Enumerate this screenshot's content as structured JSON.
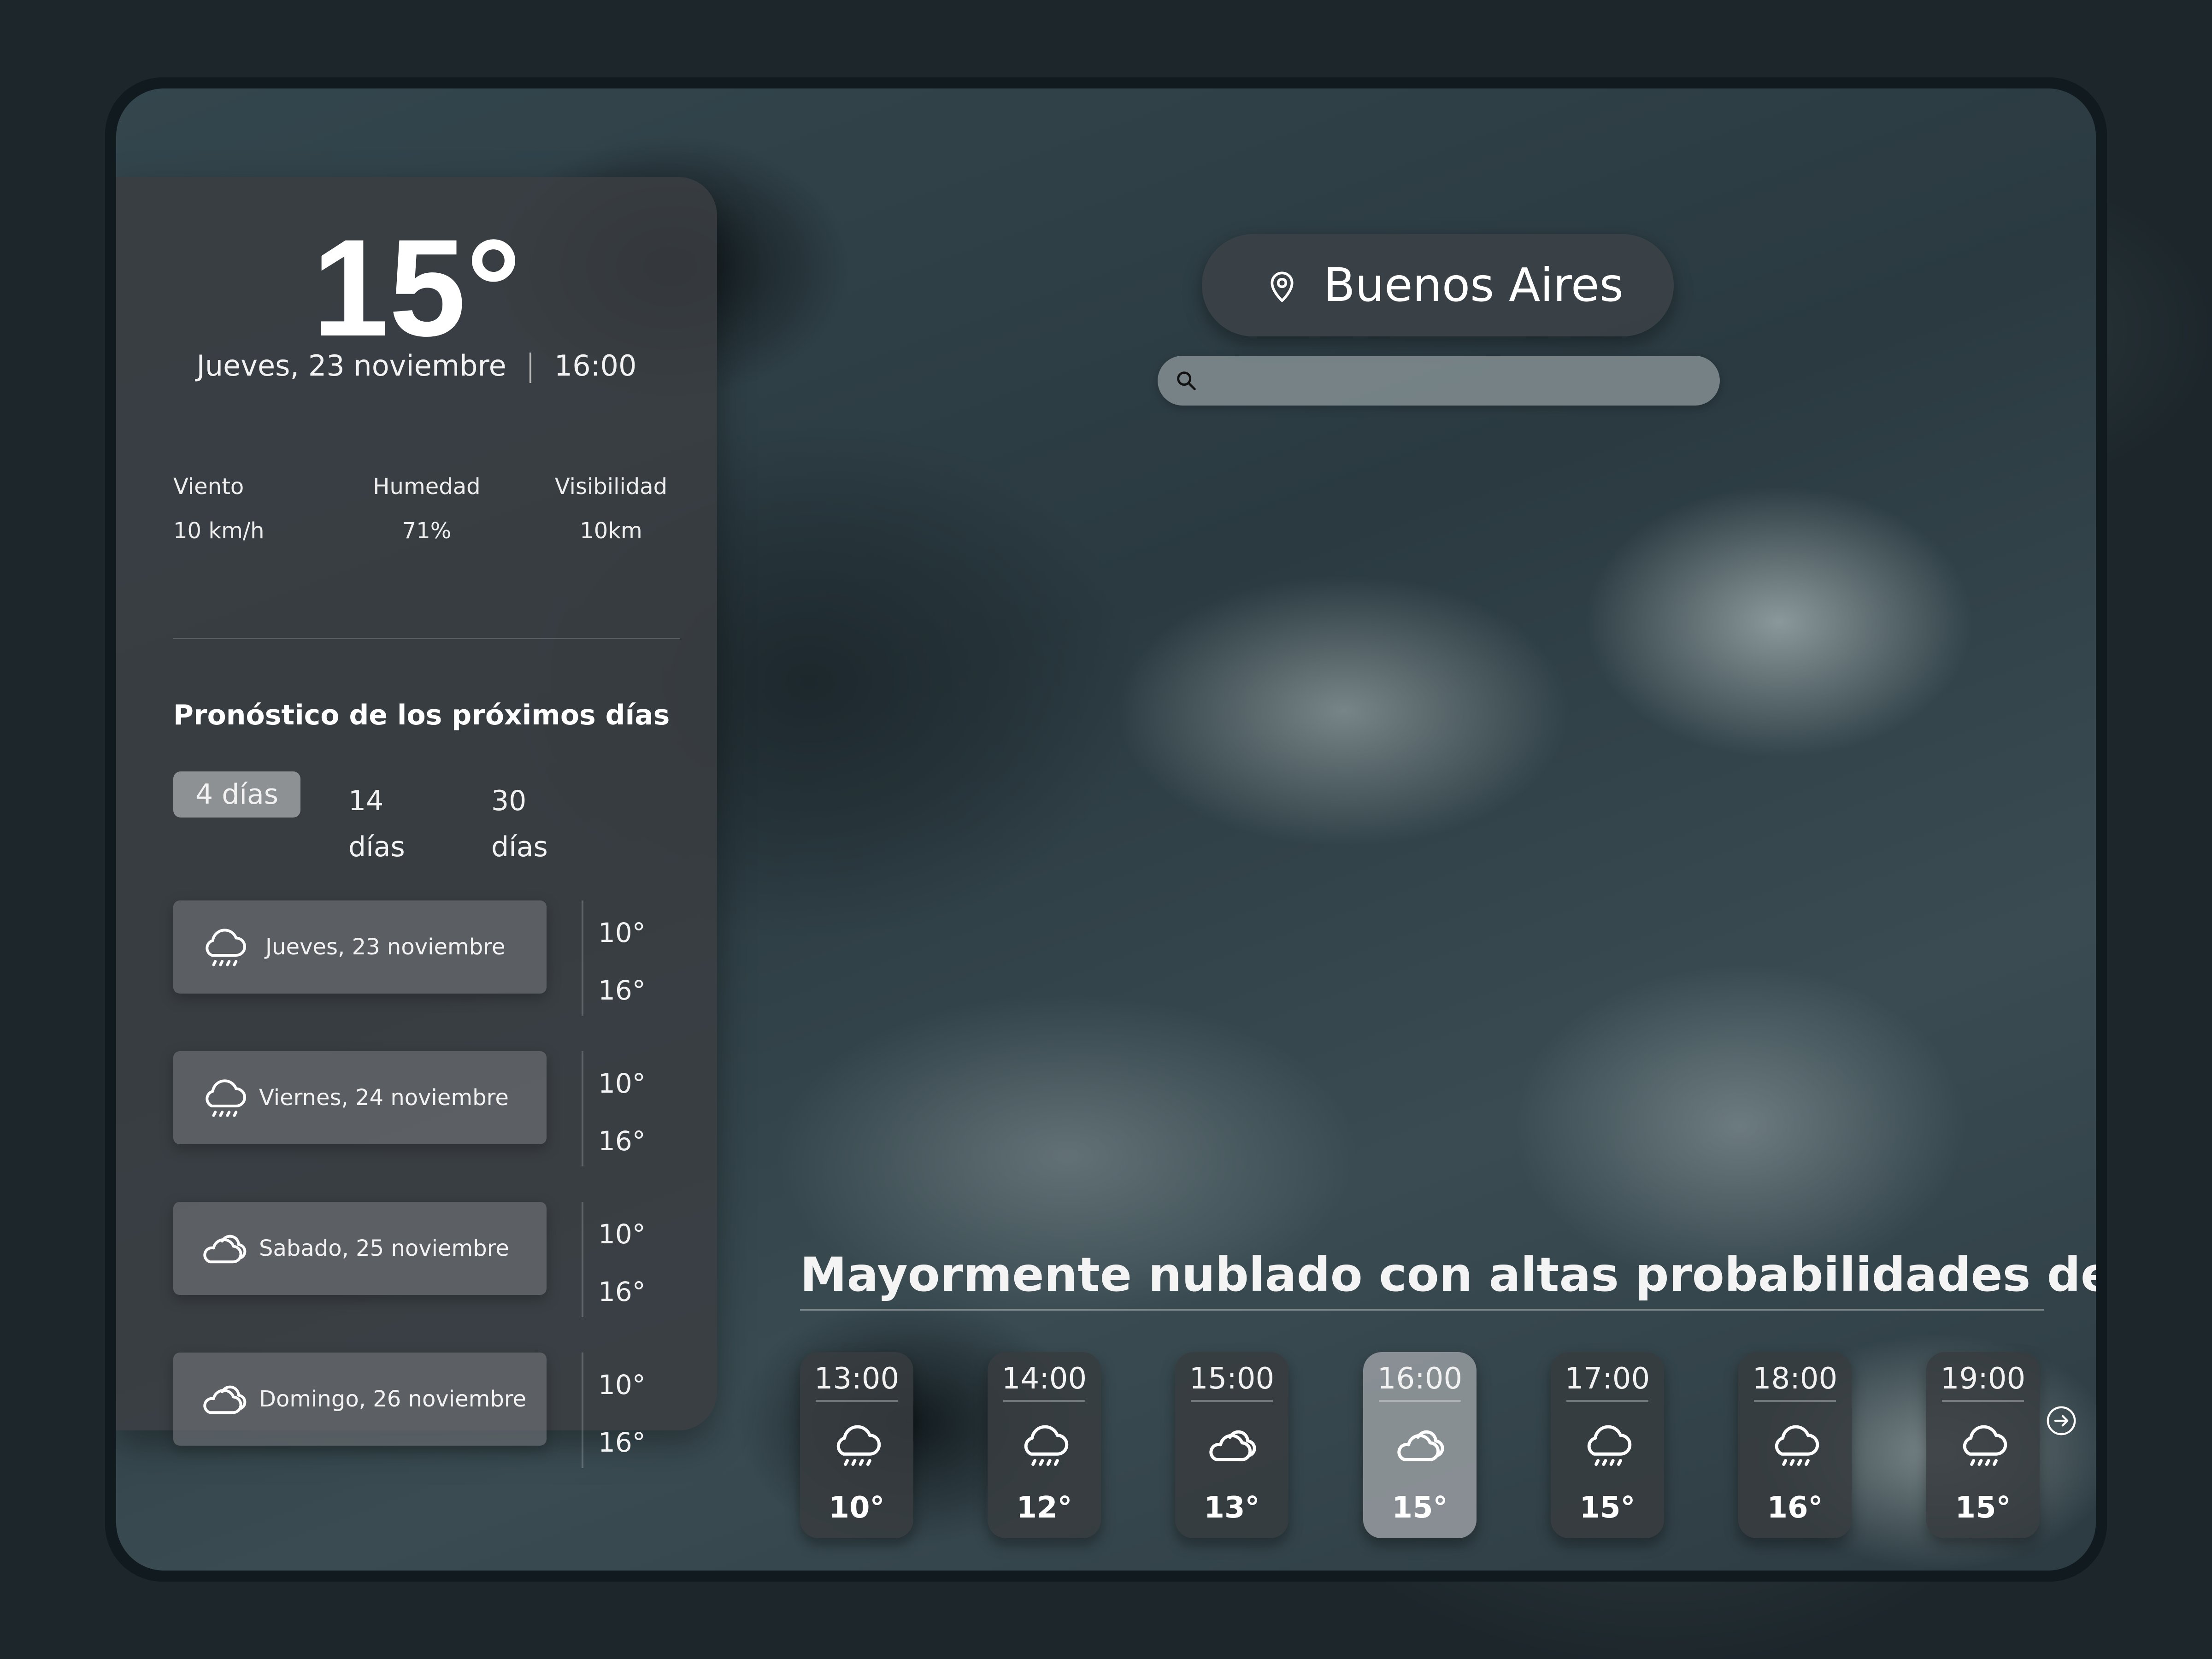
{
  "current": {
    "temperature": "15°",
    "date": "Jueves, 23 noviembre",
    "time": "16:00",
    "stats": [
      {
        "label": "Viento",
        "value": "10 km/h"
      },
      {
        "label": "Humedad",
        "value": "71%"
      },
      {
        "label": "Visibilidad",
        "value": "10km"
      }
    ]
  },
  "forecast": {
    "title": "Pronóstico de los próximos días",
    "tabs": [
      "4 días",
      "14 días",
      "30 días"
    ],
    "active_tab": "4 días",
    "days": [
      {
        "name": "Jueves, 23 noviembre",
        "icon": "rain-icon",
        "low": "10°",
        "high": "16°"
      },
      {
        "name": "Viernes, 24 noviembre",
        "icon": "rain-icon",
        "low": "10°",
        "high": "16°"
      },
      {
        "name": "Sabado, 25 noviembre",
        "icon": "cloudy-icon",
        "low": "10°",
        "high": "16°"
      },
      {
        "name": "Domingo, 26 noviembre",
        "icon": "cloudy-icon",
        "low": "10°",
        "high": "16°"
      }
    ]
  },
  "location": {
    "name": "Buenos Aires",
    "icon": "location-pin-icon"
  },
  "search": {
    "placeholder": "",
    "value": ""
  },
  "condition": "Mayormente nublado con altas probabilidades de lluvia",
  "hourly": [
    {
      "time": "13:00",
      "icon": "rain-icon",
      "temp": "10°"
    },
    {
      "time": "14:00",
      "icon": "rain-icon",
      "temp": "12°"
    },
    {
      "time": "15:00",
      "icon": "cloudy-icon",
      "temp": "13°"
    },
    {
      "time": "16:00",
      "icon": "cloudy-icon",
      "temp": "15°",
      "active": true
    },
    {
      "time": "17:00",
      "icon": "rain-icon",
      "temp": "15°"
    },
    {
      "time": "18:00",
      "icon": "rain-icon",
      "temp": "16°"
    },
    {
      "time": "19:00",
      "icon": "rain-icon",
      "temp": "15°"
    }
  ],
  "next_button_icon": "arrow-right-circle-icon"
}
